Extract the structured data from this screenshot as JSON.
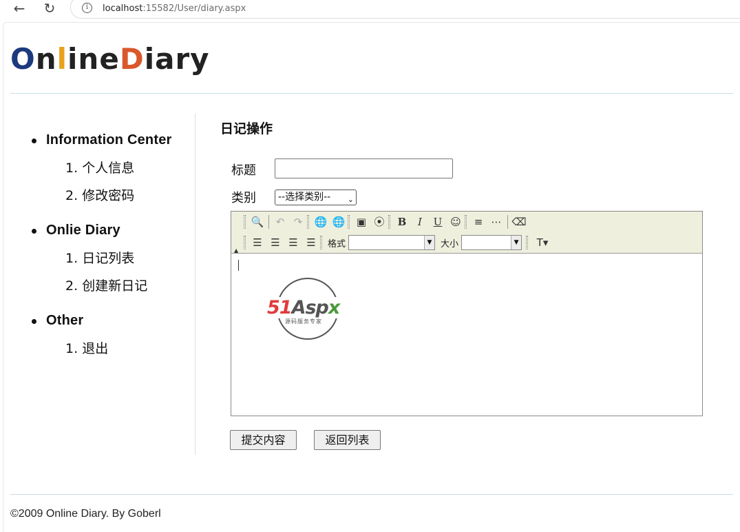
{
  "browser": {
    "url_host": "localhost",
    "url_path": ":15582/User/diary.aspx"
  },
  "logo": {
    "part1": "O",
    "part2": "n",
    "part3": "l",
    "part4": "ine",
    "part5": "D",
    "part6": "iary"
  },
  "sidebar": {
    "sections": [
      {
        "title": "Information Center",
        "items": [
          {
            "num": "1.",
            "label": "个人信息"
          },
          {
            "num": "2.",
            "label": "修改密码"
          }
        ]
      },
      {
        "title": "Onlie Diary",
        "items": [
          {
            "num": "1.",
            "label": "日记列表"
          },
          {
            "num": "2.",
            "label": "创建新日记"
          }
        ]
      },
      {
        "title": "Other",
        "items": [
          {
            "num": "1.",
            "label": "退出"
          }
        ]
      }
    ]
  },
  "main": {
    "title": "日记操作",
    "title_label": "标题",
    "title_value": "",
    "category_label": "类别",
    "category_selected": "--选择类别--",
    "editor": {
      "format_label": "格式",
      "size_label": "大小",
      "format_value": "",
      "size_value": ""
    },
    "watermark": {
      "brand_51": "51",
      "brand_a": "Asp",
      "brand_x": "x",
      "tagline": "源码服务专家"
    },
    "submit_label": "提交内容",
    "back_label": "返回列表"
  },
  "footer": {
    "text": "©2009 Online Diary. By Goberl"
  }
}
